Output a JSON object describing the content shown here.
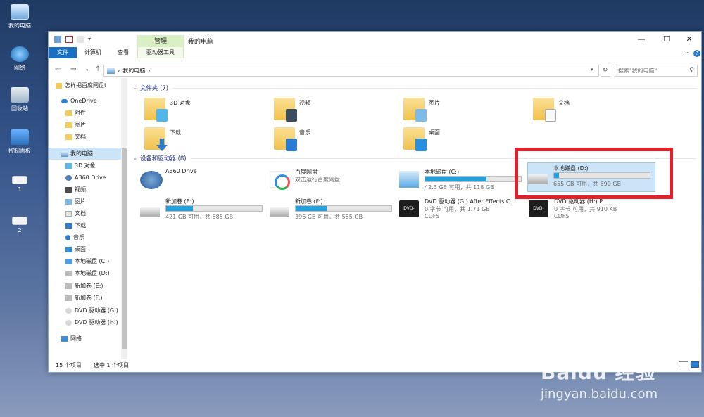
{
  "desktop": {
    "icons": [
      {
        "label": "我的电脑"
      },
      {
        "label": "网络"
      },
      {
        "label": "回收站"
      },
      {
        "label": "控制面板"
      },
      {
        "label": "1"
      },
      {
        "label": "2"
      }
    ]
  },
  "window": {
    "title": "我的电脑",
    "context_tab": "管理",
    "ribbon_tabs": {
      "file": "文件",
      "computer": "计算机",
      "view": "查看",
      "drive_tools": "驱动器工具"
    },
    "controls": {
      "minimize": "—",
      "maximize": "☐",
      "close": "✕"
    }
  },
  "address": {
    "path": "我的电脑",
    "path_sep": "›",
    "search_placeholder": "搜索\"我的电脑\""
  },
  "navpane": {
    "items": [
      {
        "label": "怎样把百度网盘t"
      },
      {
        "label": "OneDrive"
      },
      {
        "label": "附件"
      },
      {
        "label": "图片"
      },
      {
        "label": "文档"
      },
      {
        "label": "我的电脑"
      },
      {
        "label": "3D 对象"
      },
      {
        "label": "A360 Drive"
      },
      {
        "label": "视频"
      },
      {
        "label": "图片"
      },
      {
        "label": "文档"
      },
      {
        "label": "下载"
      },
      {
        "label": "音乐"
      },
      {
        "label": "桌面"
      },
      {
        "label": "本地磁盘 (C:)"
      },
      {
        "label": "本地磁盘 (D:)"
      },
      {
        "label": "新加卷 (E:)"
      },
      {
        "label": "新加卷 (F:)"
      },
      {
        "label": "DVD 驱动器 (G:)"
      },
      {
        "label": "DVD 驱动器 (H:)"
      },
      {
        "label": "网络"
      }
    ]
  },
  "folders": {
    "header": "文件夹 (7)",
    "items": [
      {
        "label": "3D 对象"
      },
      {
        "label": "视频"
      },
      {
        "label": "图片"
      },
      {
        "label": "文档"
      },
      {
        "label": "下载"
      },
      {
        "label": "音乐"
      },
      {
        "label": "桌面"
      }
    ]
  },
  "devices": {
    "header": "设备和驱动器 (8)",
    "items": [
      {
        "label": "A360 Drive",
        "status": ""
      },
      {
        "label": "百度网盘",
        "status": "双击运行百度网盘"
      },
      {
        "label": "本地磁盘 (C:)",
        "status": "42.3 GB 可用，共 118 GB",
        "used_fraction": 0.64
      },
      {
        "label": "本地磁盘 (D:)",
        "status": "655 GB 可用，共 690 GB",
        "used_fraction": 0.05
      },
      {
        "label": "新加卷 (E:)",
        "status": "421 GB 可用，共 585 GB",
        "used_fraction": 0.28
      },
      {
        "label": "新加卷 (F:)",
        "status": "396 GB 可用，共 585 GB",
        "used_fraction": 0.32
      },
      {
        "label": "DVD 驱动器 (G:) After Effects C",
        "status": "0 字节 可用，共 1.71 GB",
        "fs": "CDFS"
      },
      {
        "label": "DVD 驱动器 (H:) P",
        "status": "0 字节 可用，共 910 KB",
        "fs": "CDFS"
      }
    ],
    "dvd_badge": "DVD-ROM"
  },
  "statusbar": {
    "count": "15 个项目",
    "selected": "选中 1 个项目"
  },
  "watermark": {
    "brand": "Baidu 经验",
    "url": "jingyan.baidu.com"
  }
}
